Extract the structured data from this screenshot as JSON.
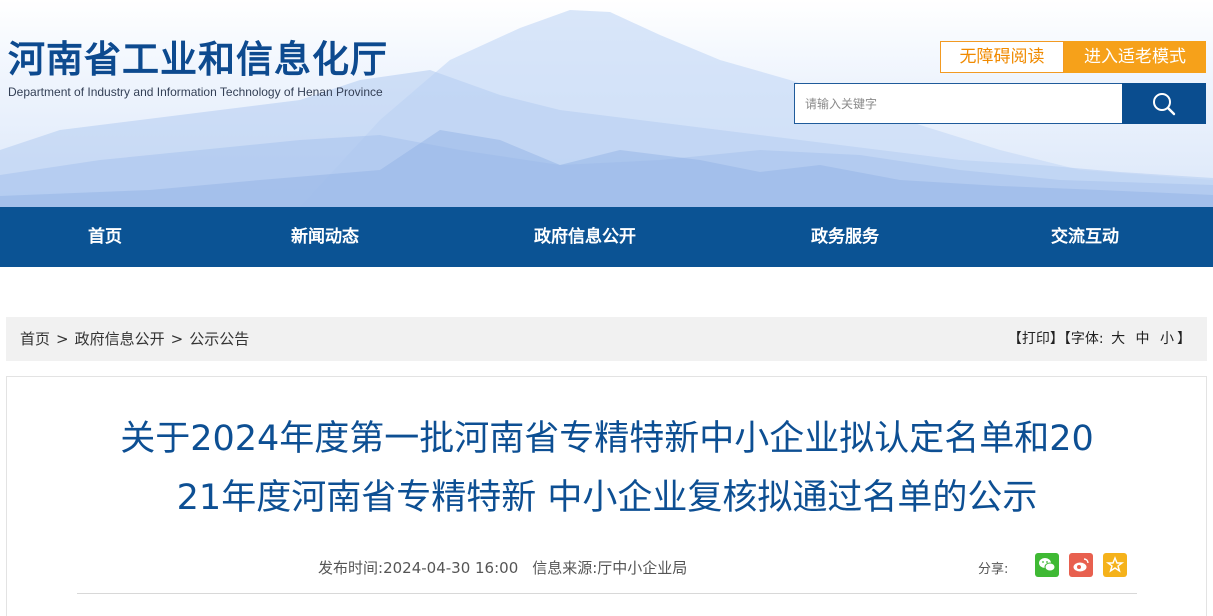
{
  "site": {
    "title_cn": "河南省工业和信息化厅",
    "title_en": "Department of Industry and Information Technology of Henan Province"
  },
  "header_buttons": {
    "accessible": "无障碍阅读",
    "elder_mode": "进入适老模式"
  },
  "search": {
    "placeholder": "请输入关键字"
  },
  "nav": {
    "items": [
      "首页",
      "新闻动态",
      "政府信息公开",
      "政务服务",
      "交流互动"
    ]
  },
  "breadcrumb": {
    "items": [
      "首页",
      "政府信息公开",
      "公示公告"
    ],
    "separator": ">"
  },
  "tools": {
    "print": "【打印】",
    "font_label": "【字体:",
    "large": "大",
    "medium": "中",
    "small": "小",
    "font_close": "】"
  },
  "article": {
    "title_line1": "关于2024年度第一批河南省专精特新中小企业拟认定名单和20",
    "title_line2": "21年度河南省专精特新 中小企业复核拟通过名单的公示",
    "publish_label": "发布时间:",
    "publish_time": "2024-04-30 16:00",
    "source_label": "信息来源:",
    "source": "厅中小企业局",
    "share_label": "分享:"
  },
  "colors": {
    "brand_blue": "#0b5394",
    "title_blue": "#0d4f93",
    "orange": "#f6a11a",
    "wechat_green": "#3fb934",
    "weibo_red": "#e8604f",
    "favorite_yellow": "#f5b21b"
  },
  "icons": {
    "search": "search-icon",
    "share": [
      "wechat-icon",
      "weibo-icon",
      "favorite-star-icon"
    ]
  }
}
